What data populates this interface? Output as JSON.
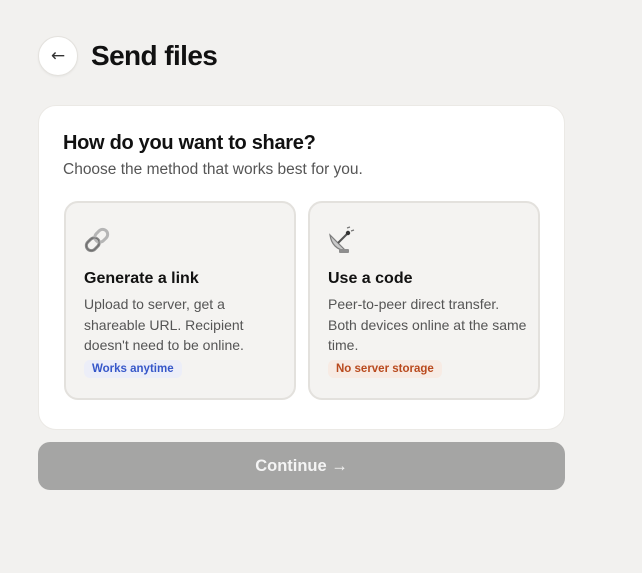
{
  "header": {
    "back_icon": "←",
    "title": "Send files"
  },
  "card": {
    "question": "How do you want to share?",
    "subtext": "Choose the method that works best for you."
  },
  "options": [
    {
      "icon": "link-icon",
      "title": "Generate a link",
      "description": "Upload to server, get a shareable URL. Recipient doesn't need to be online.",
      "badge": "Works anytime",
      "badge_color": "#3657c9"
    },
    {
      "icon": "satellite-dish-icon",
      "title": "Use a code",
      "description": "Peer-to-peer direct transfer. Both devices online at the same time.",
      "badge": "No server storage",
      "badge_color": "#b94a1e"
    }
  ],
  "footer": {
    "continue_label": "Continue →"
  },
  "colors": {
    "background": "#f2f1ef",
    "card": "#ffffff",
    "option_background": "#f4f3f1",
    "continue_disabled": "#a5a5a4"
  }
}
